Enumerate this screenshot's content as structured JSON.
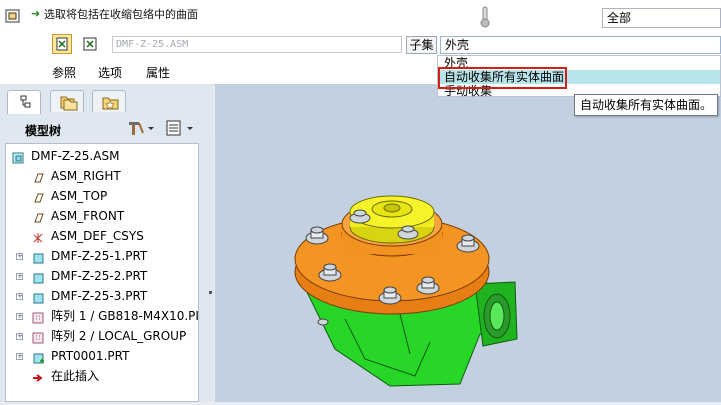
{
  "dashboard": {
    "hint": "选取将包括在收缩包络中的曲面",
    "reference_field_value": "DMF-Z-25.ASM",
    "subset_button": "子集",
    "filter_value": "全部",
    "tabs": [
      "参照",
      "选项",
      "属性"
    ]
  },
  "dropdown": {
    "selected": "外壳",
    "options": [
      "外壳",
      "自动收集所有实体曲面",
      "手动收集"
    ],
    "highlighted_index": 1,
    "tooltip": "自动收集所有实体曲面。"
  },
  "left_panel": {
    "tree_title": "模型树",
    "tree": [
      {
        "label": "DMF-Z-25.ASM",
        "icon": "assembly-icon",
        "expandable": false
      },
      {
        "label": "ASM_RIGHT",
        "icon": "datum-plane-icon",
        "expandable": false
      },
      {
        "label": "ASM_TOP",
        "icon": "datum-plane-icon",
        "expandable": false
      },
      {
        "label": "ASM_FRONT",
        "icon": "datum-plane-icon",
        "expandable": false
      },
      {
        "label": "ASM_DEF_CSYS",
        "icon": "csys-icon",
        "expandable": false
      },
      {
        "label": "DMF-Z-25-1.PRT",
        "icon": "part-icon",
        "expandable": true
      },
      {
        "label": "DMF-Z-25-2.PRT",
        "icon": "part-icon",
        "expandable": true
      },
      {
        "label": "DMF-Z-25-3.PRT",
        "icon": "part-icon",
        "expandable": true
      },
      {
        "label": "阵列 1 / GB818-M4X10.PI",
        "icon": "pattern-icon",
        "expandable": true
      },
      {
        "label": "阵列 2 / LOCAL_GROUP",
        "icon": "pattern-icon",
        "expandable": true
      },
      {
        "label": "PRT0001.PRT",
        "icon": "new-part-icon",
        "expandable": true
      },
      {
        "label": "在此插入",
        "icon": "insert-arrow-icon",
        "expandable": false
      }
    ]
  },
  "colors": {
    "highlight_border": "#d0201a",
    "dropdown_highlight": "#b7e4ea",
    "graphics_bg": "#c3d0e0",
    "part_green": "#22e022",
    "part_orange": "#f08a1e",
    "part_yellow": "#f2ee1a"
  }
}
